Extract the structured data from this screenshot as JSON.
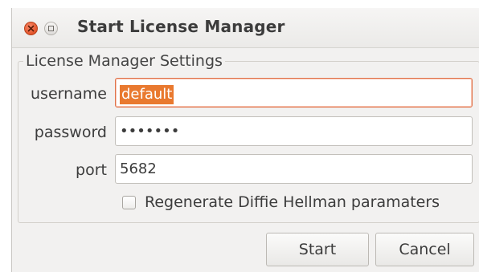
{
  "window": {
    "title": "Start License Manager"
  },
  "titlebar": {
    "close_icon": "close-icon",
    "minimize_icon": "minimize-icon"
  },
  "settings": {
    "group_title": "License Manager Settings",
    "username": {
      "label": "username",
      "value": "default"
    },
    "password": {
      "label": "password",
      "value": "•••••••"
    },
    "port": {
      "label": "port",
      "value": "5682"
    },
    "regenerate": {
      "label": "Regenerate Diffie Hellman paramaters",
      "checked": false
    }
  },
  "buttons": {
    "start_label": "Start",
    "cancel_label": "Cancel"
  },
  "colors": {
    "accent": "#e9792f",
    "close_button": "#e3542a"
  }
}
